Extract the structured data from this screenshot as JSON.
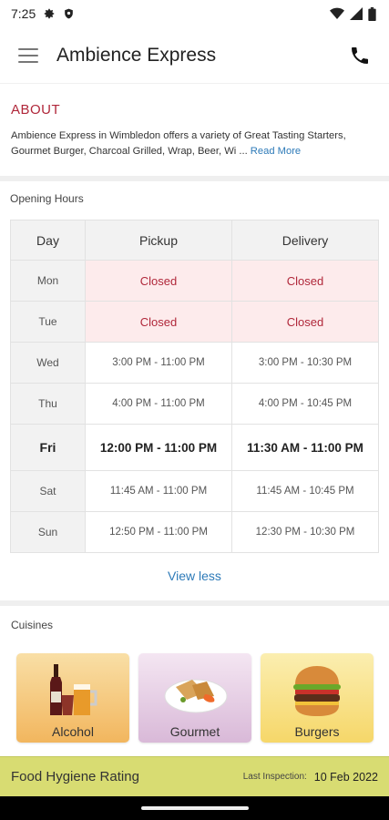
{
  "status": {
    "time": "7:25"
  },
  "app_bar": {
    "title": "Ambience Express"
  },
  "about": {
    "title": "ABOUT",
    "text": "Ambience Express in Wimbledon offers a variety of Great Tasting Starters, Gourmet Burger, Charcoal Grilled, Wrap, Beer, Wi ...",
    "read_more": "Read More"
  },
  "hours": {
    "title": "Opening Hours",
    "headers": [
      "Day",
      "Pickup",
      "Delivery"
    ],
    "rows": [
      {
        "day": "Mon",
        "pickup": "Closed",
        "delivery": "Closed"
      },
      {
        "day": "Tue",
        "pickup": "Closed",
        "delivery": "Closed"
      },
      {
        "day": "Wed",
        "pickup": "3:00 PM - 11:00 PM",
        "delivery": "3:00 PM - 10:30 PM"
      },
      {
        "day": "Thu",
        "pickup": "4:00 PM - 11:00 PM",
        "delivery": "4:00 PM - 10:45 PM"
      },
      {
        "day": "Fri",
        "pickup": "12:00 PM - 11:00 PM",
        "delivery": "11:30 AM - 11:00 PM"
      },
      {
        "day": "Sat",
        "pickup": "11:45 AM - 11:00 PM",
        "delivery": "11:45 AM - 10:45 PM"
      },
      {
        "day": "Sun",
        "pickup": "12:50 PM - 11:00 PM",
        "delivery": "12:30 PM - 10:30 PM"
      }
    ],
    "view_less": "View less"
  },
  "cuisines": {
    "title": "Cuisines",
    "items": [
      {
        "label": "Alcohol",
        "icon": "alcohol-icon",
        "bg_top": "#f9dfa6",
        "bg_bottom": "#f2b65e"
      },
      {
        "label": "Gourmet",
        "icon": "gourmet-icon",
        "bg_top": "#f4e6f2",
        "bg_bottom": "#d9b9d8"
      },
      {
        "label": "Burgers",
        "icon": "burger-icon",
        "bg_top": "#fbeeb0",
        "bg_bottom": "#f6d769"
      }
    ]
  },
  "hygiene": {
    "title": "Food Hygiene Rating",
    "label": "Last Inspection:",
    "date": "10 Feb 2022"
  },
  "colors": {
    "accent_red": "#b0273a",
    "link_blue": "#2d7ab8",
    "hygiene_bg": "#d8dc72"
  }
}
